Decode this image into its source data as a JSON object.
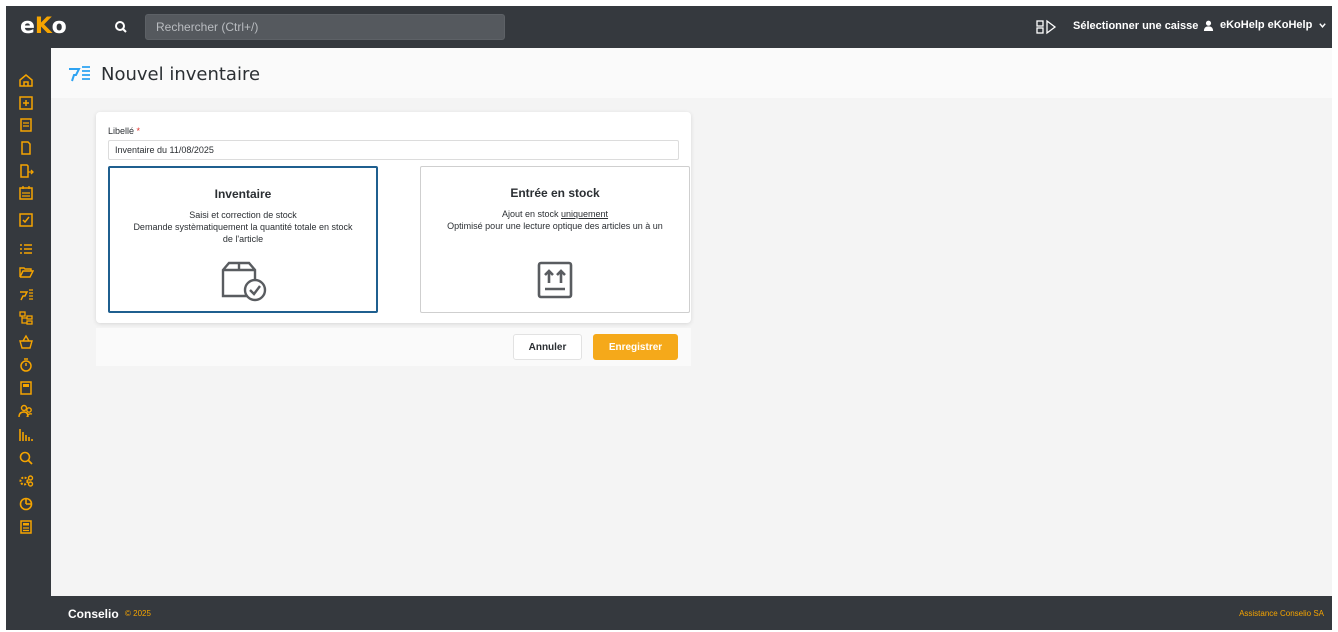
{
  "app": {
    "logo": "eKo"
  },
  "search": {
    "placeholder": "Rechercher (Ctrl+/)"
  },
  "topbar": {
    "register_label": "Sélectionner une caisse",
    "user_label": "eKoHelp eKoHelp"
  },
  "sidebar": {
    "items": [
      {
        "icon": "home-icon"
      },
      {
        "icon": "plus-square-icon"
      },
      {
        "icon": "receipt-icon"
      },
      {
        "icon": "document-icon"
      },
      {
        "icon": "document-export-icon"
      },
      {
        "icon": "calendar-icon"
      },
      {
        "icon": "checklist-icon"
      },
      {
        "icon": "list-icon"
      },
      {
        "icon": "folder-open-icon"
      },
      {
        "icon": "scanner-icon"
      },
      {
        "icon": "hierarchy-icon"
      },
      {
        "icon": "basket-icon"
      },
      {
        "icon": "timer-icon"
      },
      {
        "icon": "pos-terminal-icon"
      },
      {
        "icon": "users-icon"
      },
      {
        "icon": "bar-chart-icon"
      },
      {
        "icon": "search-icon"
      },
      {
        "icon": "settings-icon"
      },
      {
        "icon": "pie-chart-icon"
      },
      {
        "icon": "calculator-icon"
      }
    ]
  },
  "page": {
    "title": "Nouvel inventaire"
  },
  "form": {
    "label": "Libellé",
    "required_mark": "*",
    "value": "Inventaire du 11/08/2025"
  },
  "options": {
    "inventory": {
      "title": "Inventaire",
      "line1": "Saisi et correction de stock",
      "line2": "Demande systèmatiquement la quantité totale en stock de l'article",
      "selected": true
    },
    "stock_entry": {
      "title": "Entrée en stock",
      "line1_prefix": "Ajout en stock ",
      "line1_underlined": "uniquement",
      "line2": "Optimisé pour une lecture optique des articles un à un",
      "selected": false
    }
  },
  "actions": {
    "cancel": "Annuler",
    "save": "Enregistrer"
  },
  "footer": {
    "brand": "Conselio",
    "copyright": "© 2025",
    "assistance": "Assistance Conselio SA"
  },
  "colors": {
    "accent": "#f5a91a",
    "dark": "#35393e",
    "selected_border": "#1f5f8f",
    "icon_blue": "#2ea3f2"
  }
}
